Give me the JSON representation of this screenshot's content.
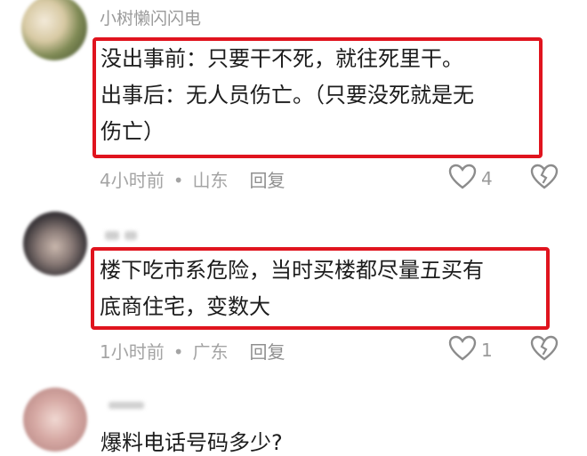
{
  "comments": [
    {
      "username": "小树懒闪闪电",
      "text_lines": [
        "没出事前：只要干不死，就往死里干。",
        "出事后：无人员伤亡。（只要没死就是无",
        "伤亡）"
      ],
      "time": "4小时前",
      "location": "山东",
      "reply_label": "回复",
      "likes": "4",
      "like_icon": "heart-outline-icon",
      "dislike_icon": "broken-heart-icon"
    },
    {
      "username": "",
      "text_lines": [
        "楼下吃市系危险，当时买楼都尽量五买有",
        "底商住宅，变数大"
      ],
      "time": "1小时前",
      "location": "广东",
      "reply_label": "回复",
      "likes": "1",
      "like_icon": "heart-outline-icon",
      "dislike_icon": "broken-heart-icon"
    },
    {
      "username": "",
      "text_lines": [
        "爆料电话号码多少?"
      ]
    }
  ],
  "colors": {
    "highlight_border": "#e0141e",
    "meta_text": "#a4a4a4"
  }
}
